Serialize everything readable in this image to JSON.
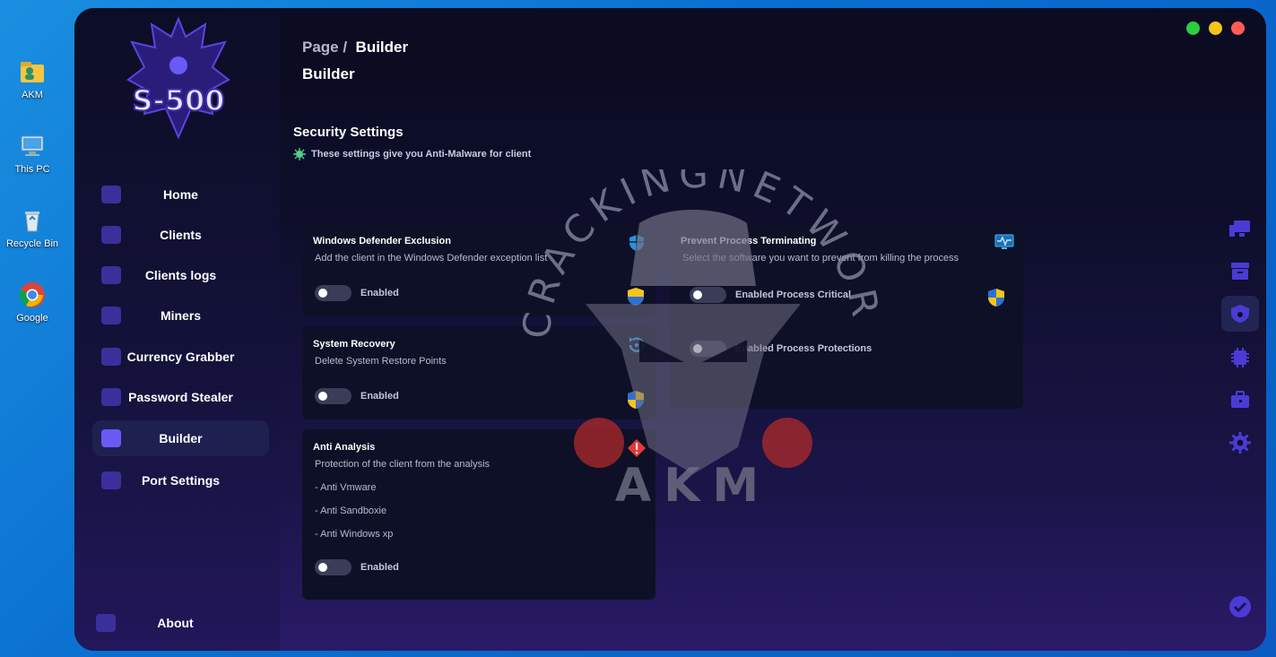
{
  "desktop": {
    "icons": [
      {
        "label": "AKM"
      },
      {
        "label": "This PC"
      },
      {
        "label": "Recycle Bin"
      },
      {
        "label": "Google"
      }
    ]
  },
  "window": {
    "logo_text": "S-500",
    "breadcrumb": {
      "prefix": "Page /",
      "current": "Builder"
    },
    "page_title": "Builder",
    "window_controls": {
      "green": "#2ecc40",
      "yellow": "#f5c518",
      "red": "#ff5c57"
    }
  },
  "sidebar": {
    "items": [
      {
        "label": "Home"
      },
      {
        "label": "Clients"
      },
      {
        "label": "Clients logs"
      },
      {
        "label": "Miners"
      },
      {
        "label": "Currency Grabber"
      },
      {
        "label": "Password Stealer"
      },
      {
        "label": "Builder"
      },
      {
        "label": "Port Settings"
      }
    ],
    "about_label": "About"
  },
  "section": {
    "title": "Security Settings",
    "subtitle": "These settings give you Anti-Malware for client"
  },
  "cards": {
    "defender": {
      "title": "Windows Defender Exclusion",
      "desc": "Add the client in the Windows Defender exception list",
      "toggle_label": "Enabled"
    },
    "recovery": {
      "title": "System Recovery",
      "desc": "Delete System Restore Points",
      "toggle_label": "Enabled"
    },
    "analysis": {
      "title": "Anti Analysis",
      "desc": "Protection of the client from the analysis",
      "items": [
        "- Anti Vmware",
        "- Anti Sandboxie",
        "- Anti Windows xp"
      ],
      "toggle_label": "Enabled"
    },
    "process": {
      "title": "Prevent Process Terminating",
      "desc": "Select the software you want to prevent from killing the process",
      "toggle1_label": "Enabled Process Critical",
      "toggle2_label": "Enabled Process Protections"
    }
  },
  "watermark": {
    "arc_text": "CRACKINGNETWORK",
    "bottom_text": "AKM"
  },
  "colors": {
    "accent": "#4b3bd6",
    "accent_light": "#6a5af5"
  }
}
